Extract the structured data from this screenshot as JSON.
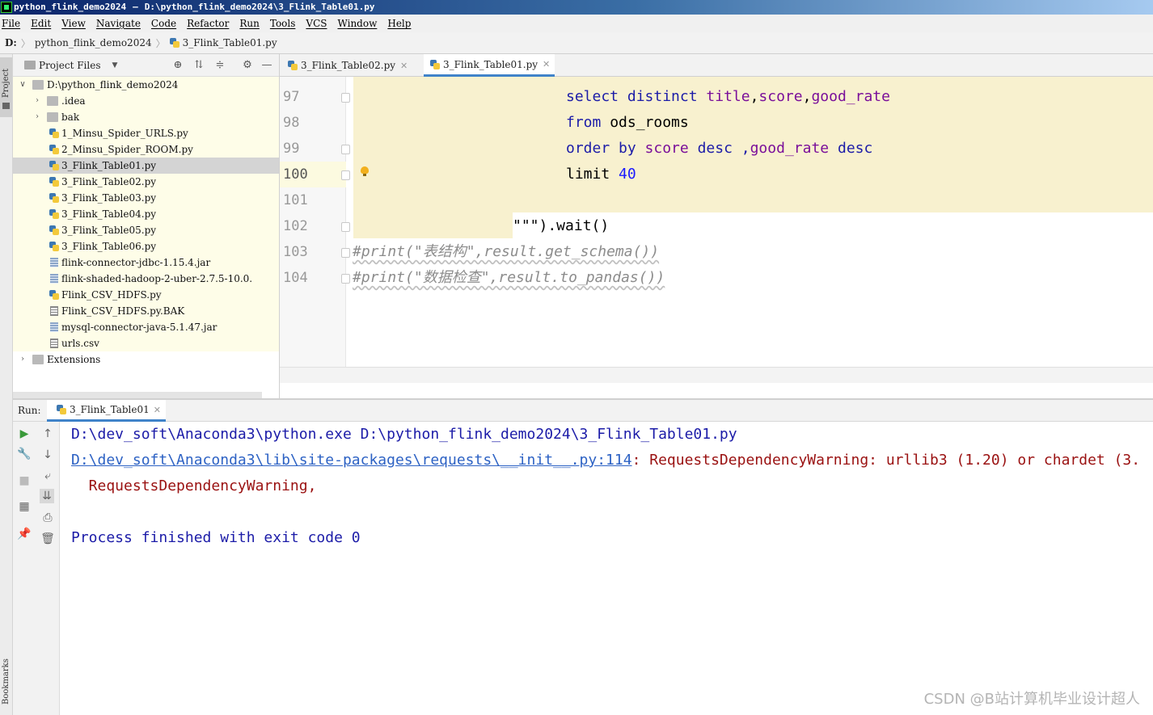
{
  "window": {
    "title_project": "python_flink_demo2024",
    "title_dash": "—",
    "title_path": "D:\\python_flink_demo2024\\3_Flink_Table01.py"
  },
  "menu": [
    "File",
    "Edit",
    "View",
    "Navigate",
    "Code",
    "Refactor",
    "Run",
    "Tools",
    "VCS",
    "Window",
    "Help"
  ],
  "breadcrumb": {
    "drive": "D:",
    "project": "python_flink_demo2024",
    "file": "3_Flink_Table01.py"
  },
  "side_strip": {
    "project_label": "Project",
    "bookmarks_label": "Bookmarks"
  },
  "project_panel": {
    "title": "Project Files",
    "root": "D:\\python_flink_demo2024",
    "items": [
      {
        "label": ".idea",
        "type": "folder"
      },
      {
        "label": "bak",
        "type": "folder"
      },
      {
        "label": "1_Minsu_Spider_URLS.py",
        "type": "py"
      },
      {
        "label": "2_Minsu_Spider_ROOM.py",
        "type": "py"
      },
      {
        "label": "3_Flink_Table01.py",
        "type": "py",
        "selected": true
      },
      {
        "label": "3_Flink_Table02.py",
        "type": "py"
      },
      {
        "label": "3_Flink_Table03.py",
        "type": "py"
      },
      {
        "label": "3_Flink_Table04.py",
        "type": "py"
      },
      {
        "label": "3_Flink_Table05.py",
        "type": "py"
      },
      {
        "label": "3_Flink_Table06.py",
        "type": "py"
      },
      {
        "label": "flink-connector-jdbc-1.15.4.jar",
        "type": "jar"
      },
      {
        "label": "flink-shaded-hadoop-2-uber-2.7.5-10.0.",
        "type": "jar"
      },
      {
        "label": "Flink_CSV_HDFS.py",
        "type": "py"
      },
      {
        "label": "Flink_CSV_HDFS.py.BAK",
        "type": "file"
      },
      {
        "label": "mysql-connector-java-5.1.47.jar",
        "type": "jar"
      },
      {
        "label": "urls.csv",
        "type": "file"
      }
    ],
    "extensions": "Extensions"
  },
  "editor_tabs": [
    {
      "label": "3_Flink_Table02.py",
      "active": false
    },
    {
      "label": "3_Flink_Table01.py",
      "active": true
    }
  ],
  "editor": {
    "line_numbers": [
      "97",
      "98",
      "99",
      "100",
      "101",
      "102",
      "103",
      "104"
    ],
    "current_line": "100",
    "code": {
      "l97_kw1": "select distinct ",
      "l97_f1": "title",
      "l97_c1": ",",
      "l97_f2": "score",
      "l97_c2": ",",
      "l97_f3": "good_rate",
      "l98_kw": "from ",
      "l98_tbl": "ods_rooms",
      "l99_kw": "order by ",
      "l99_f1": "score",
      "l99_kw2": " desc ,",
      "l99_f2": "good_rate",
      "l99_kw3": " desc",
      "l100_kw": "limit ",
      "l100_num": "40",
      "l102": "\"\"\").wait()",
      "l103": "#print(\"表结构\",result.get_schema())",
      "l104": "#print(\"数据检查\",result.to_pandas())"
    }
  },
  "run_panel": {
    "label": "Run:",
    "tab": "3_Flink_Table01",
    "output": {
      "line1": "D:\\dev_soft\\Anaconda3\\python.exe D:\\python_flink_demo2024\\3_Flink_Table01.py",
      "line2_link": "D:\\dev_soft\\Anaconda3\\lib\\site-packages\\requests\\__init__.py:114",
      "line2_msg": ": RequestsDependencyWarning: urllib3 (1.20) or chardet (3.",
      "line3": "  RequestsDependencyWarning,",
      "line5": "Process finished with exit code 0"
    }
  },
  "watermark": "CSDN @B站计算机毕业设计超人",
  "colors": {
    "accent": "#4083c9",
    "sql_bg": "#f8f1cf",
    "keyword": "#1c1ca8",
    "field": "#7a0f9a",
    "warning": "#9a1111"
  }
}
